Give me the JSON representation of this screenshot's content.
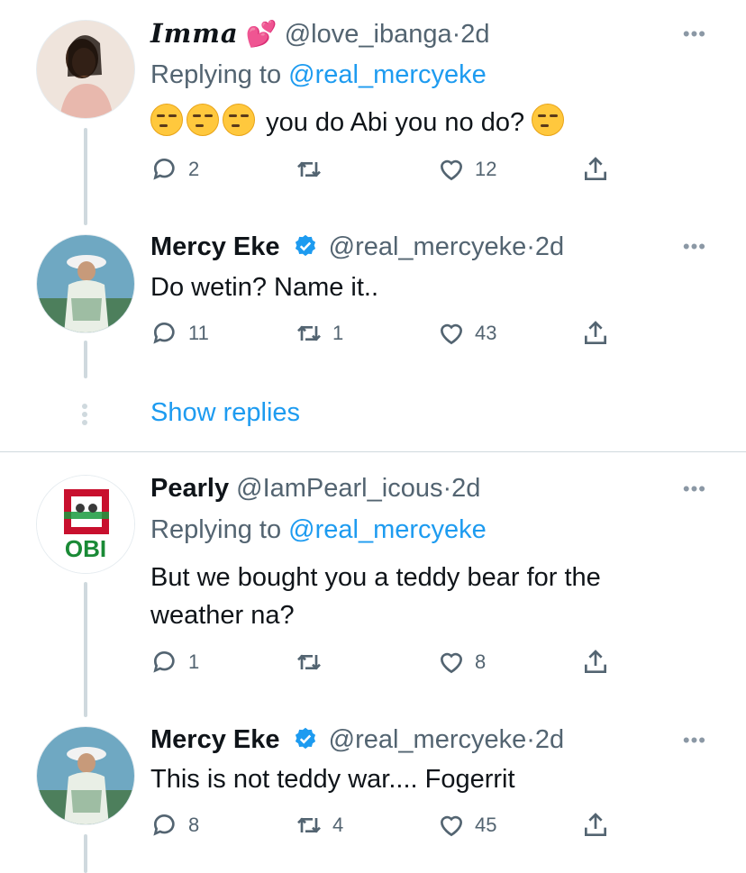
{
  "tweets": [
    {
      "name": "Imma",
      "handle": "@love_ibanga",
      "time": "2d",
      "replying_prefix": "Replying to",
      "replying_to": "@real_mercyeke",
      "text": "you do Abi you no do?",
      "replies": "2",
      "retweets": "",
      "likes": "12"
    },
    {
      "name": "Mercy Eke",
      "handle": "@real_mercyeke",
      "time": "2d",
      "text": "Do wetin? Name it..",
      "replies": "11",
      "retweets": "1",
      "likes": "43"
    },
    {
      "name": "Pearly",
      "handle": "@IamPearl_icous",
      "time": "2d",
      "replying_prefix": "Replying to",
      "replying_to": "@real_mercyeke",
      "text": "But we bought you a teddy bear for the weather na?",
      "replies": "1",
      "retweets": "",
      "likes": "8",
      "avatar_label": "OBI"
    },
    {
      "name": "Mercy Eke",
      "handle": "@real_mercyeke",
      "time": "2d",
      "text": "This is not teddy war.... Fogerrit",
      "replies": "8",
      "retweets": "4",
      "likes": "45"
    }
  ],
  "show_replies_label": "Show replies",
  "dot_separator": "·",
  "more_label": "•••",
  "colors": {
    "accent": "#1d9bf0",
    "muted": "#536471",
    "line": "#cfd9de"
  }
}
